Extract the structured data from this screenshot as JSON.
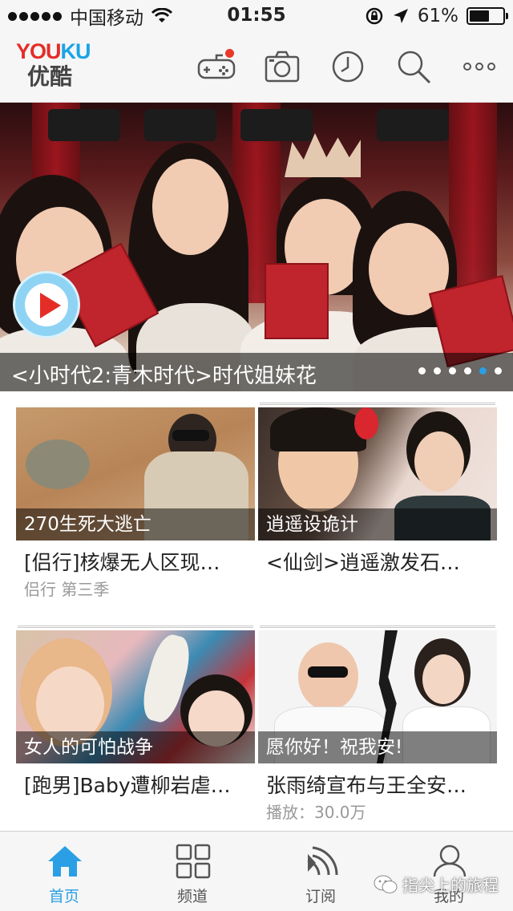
{
  "status_bar": {
    "carrier": "中国移动",
    "time": "01:55",
    "battery": "61%",
    "battery_level": 0.61
  },
  "header": {
    "logo_en": "YOUKU",
    "logo_cn": "优酷",
    "icons": [
      "game-controller-icon",
      "camera-icon",
      "history-clock-icon",
      "search-icon",
      "more-icon"
    ]
  },
  "banner": {
    "caption": "<小时代2:青木时代>时代姐妹花",
    "pages": 6,
    "active_page": 5
  },
  "cards": [
    {
      "overlay": "270生死大逃亡",
      "title": "[侣行]核爆无人区现…",
      "sub": "侣行 第三季"
    },
    {
      "overlay": "逍遥设诡计",
      "title": "<仙剑>逍遥激发石…",
      "sub": ""
    },
    {
      "overlay": "女人的可怕战争",
      "title": "[跑男]Baby遭柳岩虐…",
      "sub": ""
    },
    {
      "overlay": "愿你好！祝我安!",
      "title": "张雨绮宣布与王全安…",
      "sub": "播放：30.0万"
    }
  ],
  "tabs": [
    {
      "label": "首页",
      "icon": "home-icon",
      "active": true
    },
    {
      "label": "频道",
      "icon": "grid-icon",
      "active": false
    },
    {
      "label": "订阅",
      "icon": "rss-icon",
      "active": false
    },
    {
      "label": "我的",
      "icon": "user-icon",
      "active": false
    }
  ],
  "watermark": "指尖上的旅程",
  "colors": {
    "brand_red": "#e52d27",
    "brand_blue": "#1aa5e6",
    "active_tab": "#2a9fe5"
  }
}
